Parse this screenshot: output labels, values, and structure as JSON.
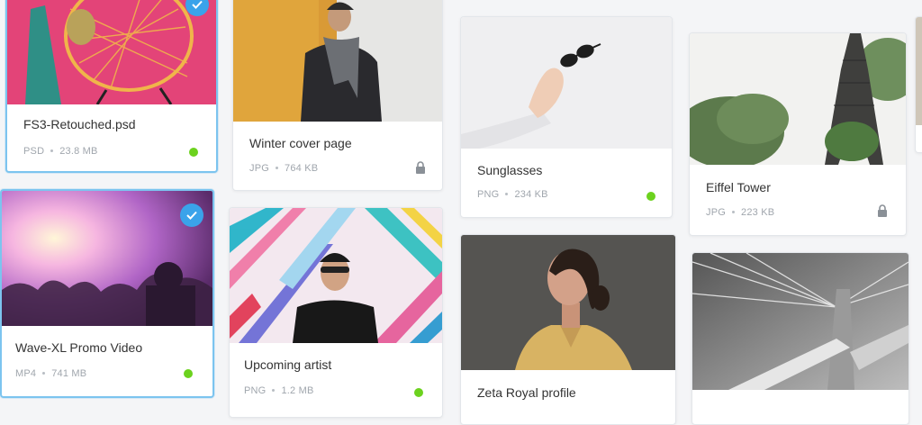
{
  "colors": {
    "accent": "#3aa3ea",
    "status_green": "#6cd21e",
    "selected_border": "#7cc4ef"
  },
  "assets": [
    {
      "title": "FS3-Retouched.psd",
      "type": "PSD",
      "size": "23.8 MB",
      "status": "available",
      "selected": true
    },
    {
      "title": "Wave-XL Promo Video",
      "type": "MP4",
      "size": "741 MB",
      "status": "available",
      "selected": true
    },
    {
      "title": "Winter cover page",
      "type": "JPG",
      "size": "764 KB",
      "status": "locked",
      "selected": false
    },
    {
      "title": "Upcoming artist",
      "type": "PNG",
      "size": "1.2 MB",
      "status": "available",
      "selected": false
    },
    {
      "title": "Sunglasses",
      "type": "PNG",
      "size": "234 KB",
      "status": "available",
      "selected": false
    },
    {
      "title": "Zeta Royal profile",
      "type": "",
      "size": "",
      "status": "",
      "selected": false
    },
    {
      "title": "Eiffel Tower",
      "type": "JPG",
      "size": "223 KB",
      "status": "locked",
      "selected": false
    },
    {
      "title": "",
      "type": "",
      "size": "",
      "status": "",
      "selected": false
    }
  ]
}
